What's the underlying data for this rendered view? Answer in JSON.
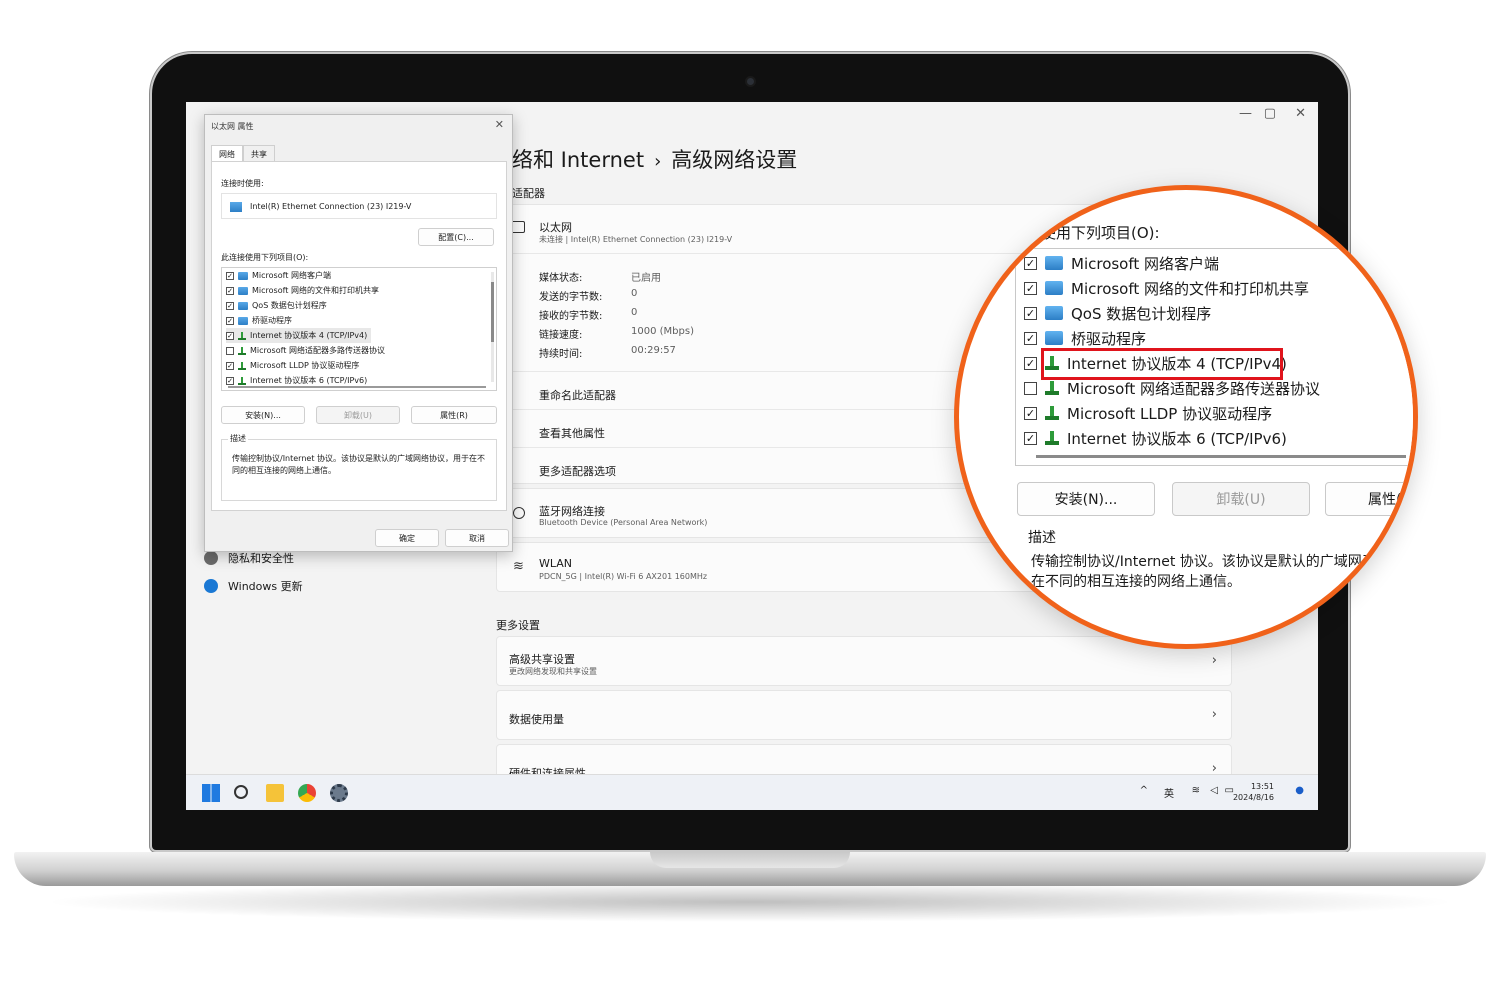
{
  "window": {
    "minimize": "—",
    "maximize": "▢",
    "close": "✕"
  },
  "settings": {
    "breadcrumb_parent": "络和 Internet",
    "breadcrumb_sep": "›",
    "breadcrumb_current": "高级网络设置",
    "section_adapters": "适配器",
    "ethernet": {
      "name": "以太网",
      "sub": "未连接 | Intel(R) Ethernet Connection (23) I219-V",
      "props": [
        {
          "key": "媒体状态:",
          "value": "已启用"
        },
        {
          "key": "发送的字节数:",
          "value": "0"
        },
        {
          "key": "接收的字节数:",
          "value": "0"
        },
        {
          "key": "链接速度:",
          "value": "1000 (Mbps)"
        },
        {
          "key": "持续时间:",
          "value": "00:29:57"
        }
      ],
      "actions": [
        "重命名此适配器",
        "查看其他属性",
        "更多适配器选项"
      ]
    },
    "bluetooth": {
      "name": "蓝牙网络连接",
      "sub": "Bluetooth Device (Personal Area Network)"
    },
    "wlan": {
      "name": "WLAN",
      "sub": "PDCN_5G | Intel(R) Wi-Fi 6 AX201 160MHz"
    },
    "section_more": "更多设置",
    "more": [
      {
        "title": "高级共享设置",
        "sub": "更改网络发现和共享设置"
      },
      {
        "title": "数据使用量",
        "sub": ""
      },
      {
        "title": "硬件和连接属性",
        "sub": ""
      }
    ],
    "sidebar": [
      {
        "label": "隐私和安全性"
      },
      {
        "label": "Windows 更新"
      }
    ]
  },
  "dialog": {
    "title": "以太网 属性",
    "close": "✕",
    "tabs": [
      "网络",
      "共享"
    ],
    "connect_using_label": "连接时使用:",
    "adapter": "Intel(R) Ethernet Connection (23) I219-V",
    "configure_button": "配置(C)...",
    "items_label": "此连接使用下列项目(O):",
    "items": [
      {
        "label": "Microsoft 网络客户端",
        "checked": true,
        "icon": "net"
      },
      {
        "label": "Microsoft 网络的文件和打印机共享",
        "checked": true,
        "icon": "net"
      },
      {
        "label": "QoS 数据包计划程序",
        "checked": true,
        "icon": "net"
      },
      {
        "label": "桥驱动程序",
        "checked": true,
        "icon": "net"
      },
      {
        "label": "Internet 协议版本 4 (TCP/IPv4)",
        "checked": true,
        "icon": "proto"
      },
      {
        "label": "Microsoft 网络适配器多路传送器协议",
        "checked": false,
        "icon": "proto"
      },
      {
        "label": "Microsoft LLDP 协议驱动程序",
        "checked": true,
        "icon": "proto"
      },
      {
        "label": "Internet 协议版本 6 (TCP/IPv6)",
        "checked": true,
        "icon": "proto"
      }
    ],
    "install_button": "安装(N)...",
    "uninstall_button": "卸载(U)",
    "properties_button": "属性(R)",
    "description_title": "描述",
    "description": "传输控制协议/Internet 协议。该协议是默认的广域网络协议，用于在不同的相互连接的网络上通信。",
    "ok_button": "确定",
    "cancel_button": "取消"
  },
  "zoom": {
    "items_label": "使用下列项目(O):",
    "items": [
      {
        "label": "Microsoft 网络客户端",
        "checked": true,
        "icon": "net"
      },
      {
        "label": "Microsoft 网络的文件和打印机共享",
        "checked": true,
        "icon": "net"
      },
      {
        "label": "QoS 数据包计划程序",
        "checked": true,
        "icon": "net"
      },
      {
        "label": "桥驱动程序",
        "checked": true,
        "icon": "net"
      },
      {
        "label": "Internet 协议版本 4 (TCP/IPv4)",
        "checked": true,
        "icon": "proto"
      },
      {
        "label": "Microsoft 网络适配器多路传送器协议",
        "checked": false,
        "icon": "proto"
      },
      {
        "label": "Microsoft LLDP 协议驱动程序",
        "checked": true,
        "icon": "proto"
      },
      {
        "label": "Internet 协议版本 6 (TCP/IPv6)",
        "checked": true,
        "icon": "proto"
      }
    ],
    "install_button": "安装(N)...",
    "uninstall_button": "卸载(U)",
    "properties_button": "属性(",
    "description_title": "描述",
    "description": "传输控制协议/Internet 协议。该协议是默认的广域网于在不同的相互连接的网络上通信。",
    "highlight_color": "#e0141c",
    "ring_color": "#f0621a"
  },
  "taskbar": {
    "tray_chevron": "^",
    "ime": "英",
    "time": "13:51",
    "date": "2024/8/16"
  }
}
